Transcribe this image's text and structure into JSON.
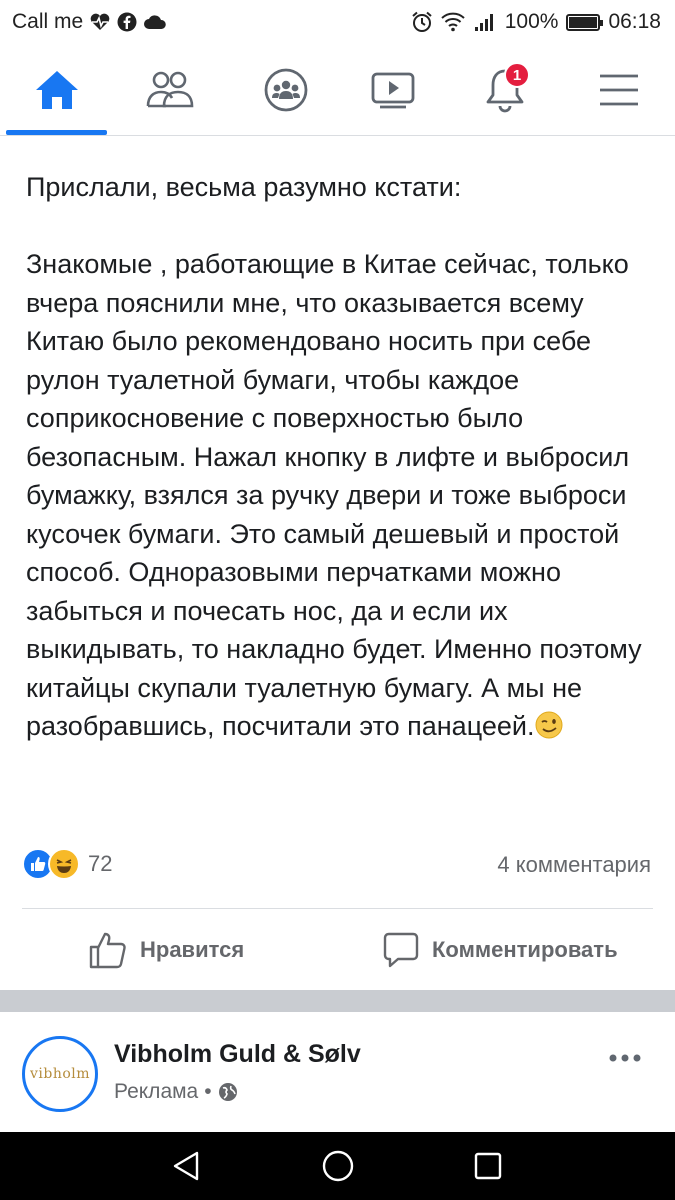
{
  "status_bar": {
    "carrier": "Call me",
    "battery": "100%",
    "time": "06:18",
    "battery_level": 1.0
  },
  "nav": {
    "items": [
      {
        "name": "home",
        "icon": "home-icon",
        "active": true
      },
      {
        "name": "friends",
        "icon": "friends-icon"
      },
      {
        "name": "groups",
        "icon": "groups-icon"
      },
      {
        "name": "watch",
        "icon": "video-icon"
      },
      {
        "name": "notifications",
        "icon": "bell-icon",
        "badge": "1"
      },
      {
        "name": "menu",
        "icon": "menu-icon"
      }
    ],
    "accent": "#1877f2"
  },
  "post": {
    "intro": "Прислали,  весьма разумно кстати:",
    "body": "Знакомые , работающие в Китае сейчас, только вчера пояснили мне, что оказывается всему Китаю было рекомендовано носить при себе рулон туалетной бумаги, чтобы каждое соприкосновение с поверхностью было безопасным. Нажал кнопку в лифте и выбросил бумажку, взялся за ручку двери и тоже выброси кусочек бумаги. Это самый дешевый и простой способ. Одноразовыми перчатками можно забыться и почесать нос, да и если их выкидывать, то накладно будет. Именно поэтому китайцы скупали туалетную бумагу. А мы не разобравшись, посчитали это панацеей.",
    "reaction_count": "72",
    "comments_count": "4 комментария",
    "like_label": "Нравится",
    "comment_label": "Комментировать"
  },
  "ad": {
    "name": "Vibholm Guld & Sølv",
    "sponsored": "Реклама",
    "separator": "•",
    "logo_text": "vibholm"
  }
}
